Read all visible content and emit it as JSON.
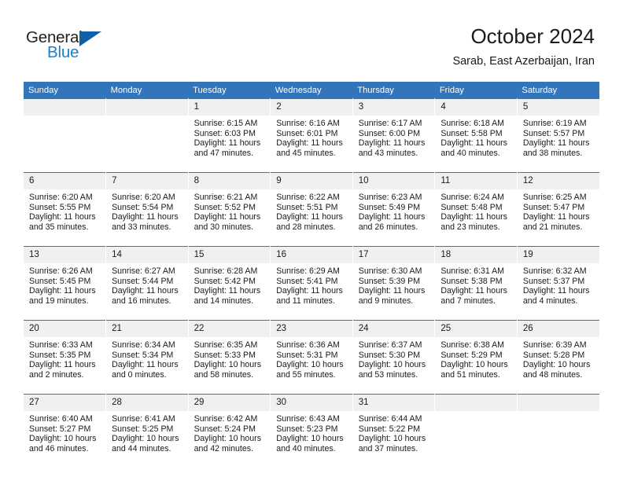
{
  "brand": {
    "name_top": "General",
    "name_bottom": "Blue",
    "accent_color": "#1060a8",
    "blue_text_color": "#1f7fc4"
  },
  "header": {
    "title": "October 2024",
    "subtitle": "Sarab, East Azerbaijan, Iran"
  },
  "theme": {
    "header_bar": "#3275ba",
    "daynum_bg": "#f0f0f0",
    "text": "#1a1a1a"
  },
  "weekday_headers": [
    "Sunday",
    "Monday",
    "Tuesday",
    "Wednesday",
    "Thursday",
    "Friday",
    "Saturday"
  ],
  "weeks": [
    [
      {
        "day": "",
        "sunrise": "",
        "sunset": "",
        "daylight": "",
        "empty": true
      },
      {
        "day": "",
        "sunrise": "",
        "sunset": "",
        "daylight": "",
        "empty": true
      },
      {
        "day": "1",
        "sunrise": "Sunrise: 6:15 AM",
        "sunset": "Sunset: 6:03 PM",
        "daylight": "Daylight: 11 hours and 47 minutes."
      },
      {
        "day": "2",
        "sunrise": "Sunrise: 6:16 AM",
        "sunset": "Sunset: 6:01 PM",
        "daylight": "Daylight: 11 hours and 45 minutes."
      },
      {
        "day": "3",
        "sunrise": "Sunrise: 6:17 AM",
        "sunset": "Sunset: 6:00 PM",
        "daylight": "Daylight: 11 hours and 43 minutes."
      },
      {
        "day": "4",
        "sunrise": "Sunrise: 6:18 AM",
        "sunset": "Sunset: 5:58 PM",
        "daylight": "Daylight: 11 hours and 40 minutes."
      },
      {
        "day": "5",
        "sunrise": "Sunrise: 6:19 AM",
        "sunset": "Sunset: 5:57 PM",
        "daylight": "Daylight: 11 hours and 38 minutes."
      }
    ],
    [
      {
        "day": "6",
        "sunrise": "Sunrise: 6:20 AM",
        "sunset": "Sunset: 5:55 PM",
        "daylight": "Daylight: 11 hours and 35 minutes."
      },
      {
        "day": "7",
        "sunrise": "Sunrise: 6:20 AM",
        "sunset": "Sunset: 5:54 PM",
        "daylight": "Daylight: 11 hours and 33 minutes."
      },
      {
        "day": "8",
        "sunrise": "Sunrise: 6:21 AM",
        "sunset": "Sunset: 5:52 PM",
        "daylight": "Daylight: 11 hours and 30 minutes."
      },
      {
        "day": "9",
        "sunrise": "Sunrise: 6:22 AM",
        "sunset": "Sunset: 5:51 PM",
        "daylight": "Daylight: 11 hours and 28 minutes."
      },
      {
        "day": "10",
        "sunrise": "Sunrise: 6:23 AM",
        "sunset": "Sunset: 5:49 PM",
        "daylight": "Daylight: 11 hours and 26 minutes."
      },
      {
        "day": "11",
        "sunrise": "Sunrise: 6:24 AM",
        "sunset": "Sunset: 5:48 PM",
        "daylight": "Daylight: 11 hours and 23 minutes."
      },
      {
        "day": "12",
        "sunrise": "Sunrise: 6:25 AM",
        "sunset": "Sunset: 5:47 PM",
        "daylight": "Daylight: 11 hours and 21 minutes."
      }
    ],
    [
      {
        "day": "13",
        "sunrise": "Sunrise: 6:26 AM",
        "sunset": "Sunset: 5:45 PM",
        "daylight": "Daylight: 11 hours and 19 minutes."
      },
      {
        "day": "14",
        "sunrise": "Sunrise: 6:27 AM",
        "sunset": "Sunset: 5:44 PM",
        "daylight": "Daylight: 11 hours and 16 minutes."
      },
      {
        "day": "15",
        "sunrise": "Sunrise: 6:28 AM",
        "sunset": "Sunset: 5:42 PM",
        "daylight": "Daylight: 11 hours and 14 minutes."
      },
      {
        "day": "16",
        "sunrise": "Sunrise: 6:29 AM",
        "sunset": "Sunset: 5:41 PM",
        "daylight": "Daylight: 11 hours and 11 minutes."
      },
      {
        "day": "17",
        "sunrise": "Sunrise: 6:30 AM",
        "sunset": "Sunset: 5:39 PM",
        "daylight": "Daylight: 11 hours and 9 minutes."
      },
      {
        "day": "18",
        "sunrise": "Sunrise: 6:31 AM",
        "sunset": "Sunset: 5:38 PM",
        "daylight": "Daylight: 11 hours and 7 minutes."
      },
      {
        "day": "19",
        "sunrise": "Sunrise: 6:32 AM",
        "sunset": "Sunset: 5:37 PM",
        "daylight": "Daylight: 11 hours and 4 minutes."
      }
    ],
    [
      {
        "day": "20",
        "sunrise": "Sunrise: 6:33 AM",
        "sunset": "Sunset: 5:35 PM",
        "daylight": "Daylight: 11 hours and 2 minutes."
      },
      {
        "day": "21",
        "sunrise": "Sunrise: 6:34 AM",
        "sunset": "Sunset: 5:34 PM",
        "daylight": "Daylight: 11 hours and 0 minutes."
      },
      {
        "day": "22",
        "sunrise": "Sunrise: 6:35 AM",
        "sunset": "Sunset: 5:33 PM",
        "daylight": "Daylight: 10 hours and 58 minutes."
      },
      {
        "day": "23",
        "sunrise": "Sunrise: 6:36 AM",
        "sunset": "Sunset: 5:31 PM",
        "daylight": "Daylight: 10 hours and 55 minutes."
      },
      {
        "day": "24",
        "sunrise": "Sunrise: 6:37 AM",
        "sunset": "Sunset: 5:30 PM",
        "daylight": "Daylight: 10 hours and 53 minutes."
      },
      {
        "day": "25",
        "sunrise": "Sunrise: 6:38 AM",
        "sunset": "Sunset: 5:29 PM",
        "daylight": "Daylight: 10 hours and 51 minutes."
      },
      {
        "day": "26",
        "sunrise": "Sunrise: 6:39 AM",
        "sunset": "Sunset: 5:28 PM",
        "daylight": "Daylight: 10 hours and 48 minutes."
      }
    ],
    [
      {
        "day": "27",
        "sunrise": "Sunrise: 6:40 AM",
        "sunset": "Sunset: 5:27 PM",
        "daylight": "Daylight: 10 hours and 46 minutes."
      },
      {
        "day": "28",
        "sunrise": "Sunrise: 6:41 AM",
        "sunset": "Sunset: 5:25 PM",
        "daylight": "Daylight: 10 hours and 44 minutes."
      },
      {
        "day": "29",
        "sunrise": "Sunrise: 6:42 AM",
        "sunset": "Sunset: 5:24 PM",
        "daylight": "Daylight: 10 hours and 42 minutes."
      },
      {
        "day": "30",
        "sunrise": "Sunrise: 6:43 AM",
        "sunset": "Sunset: 5:23 PM",
        "daylight": "Daylight: 10 hours and 40 minutes."
      },
      {
        "day": "31",
        "sunrise": "Sunrise: 6:44 AM",
        "sunset": "Sunset: 5:22 PM",
        "daylight": "Daylight: 10 hours and 37 minutes."
      },
      {
        "day": "",
        "sunrise": "",
        "sunset": "",
        "daylight": "",
        "empty": true
      },
      {
        "day": "",
        "sunrise": "",
        "sunset": "",
        "daylight": "",
        "empty": true
      }
    ]
  ]
}
